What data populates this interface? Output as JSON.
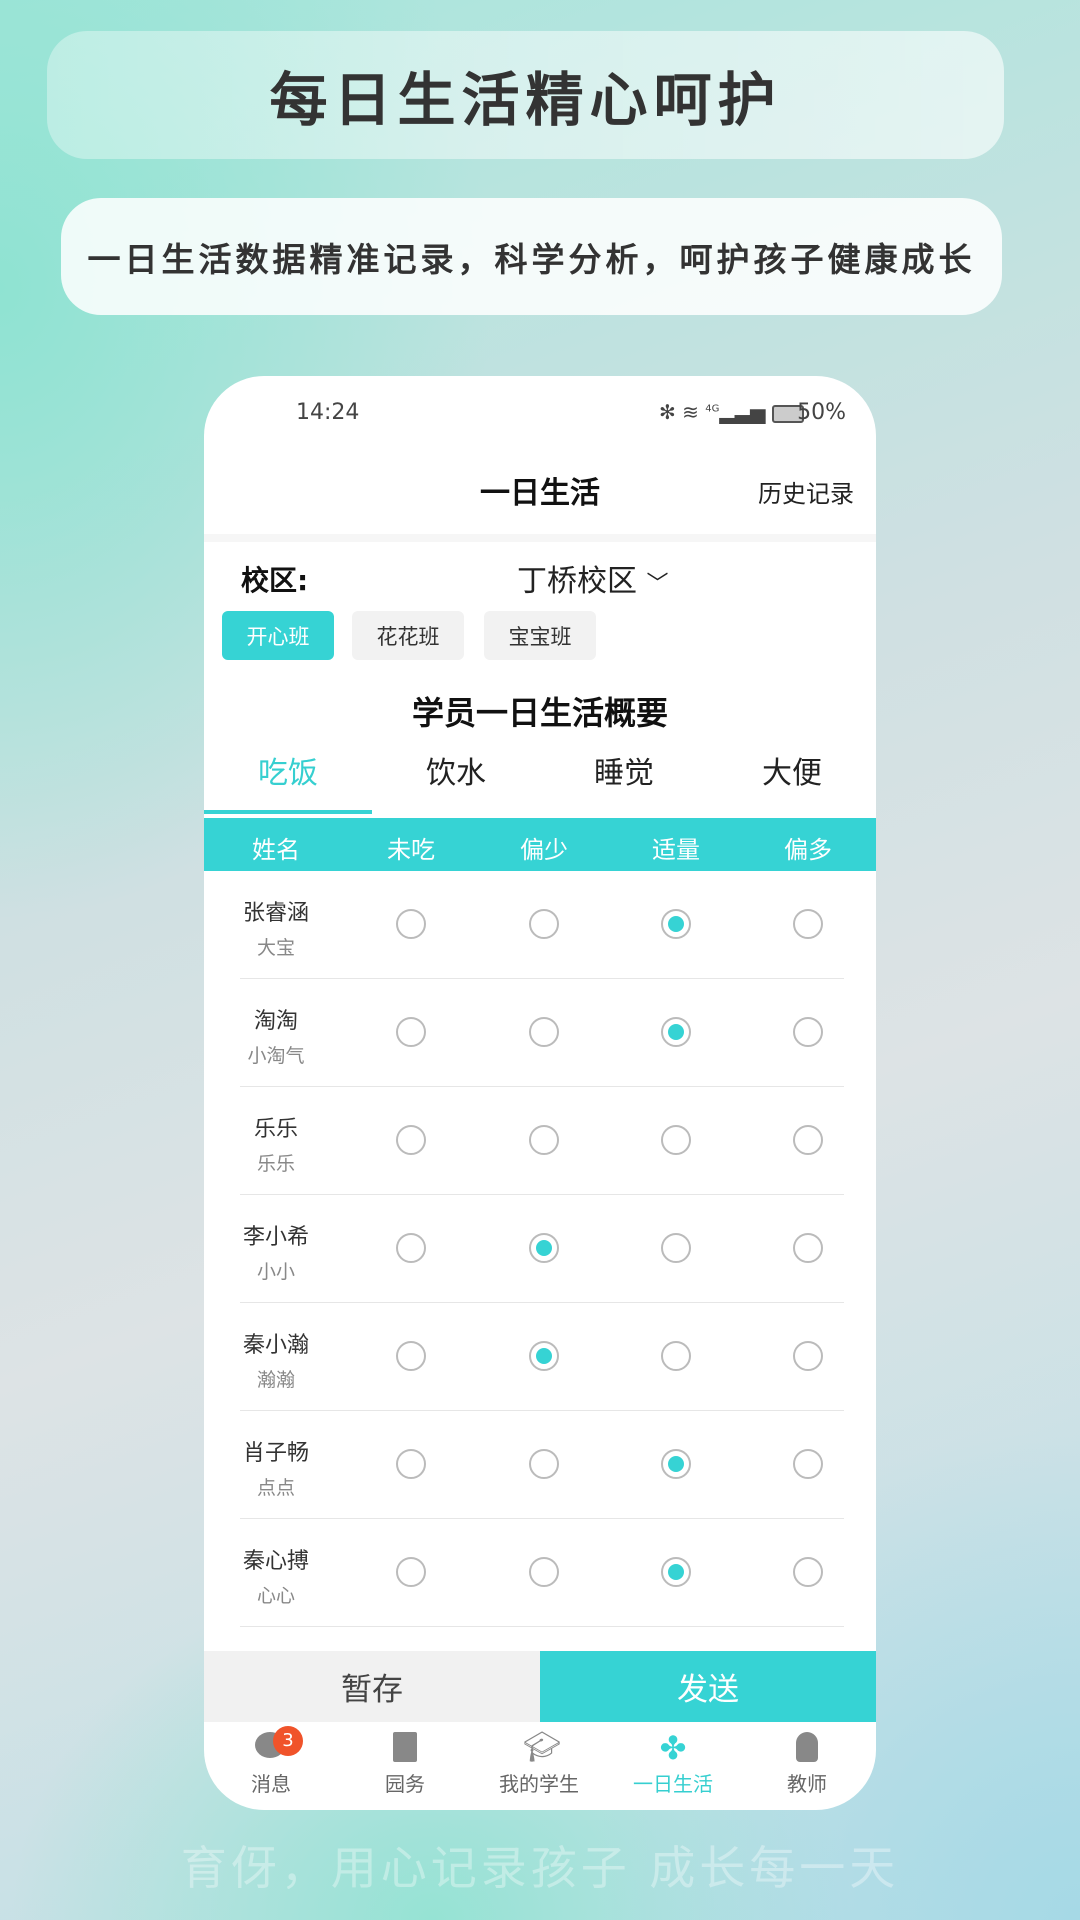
{
  "banner": {
    "title": "每日生活精心呵护",
    "subtitle": "一日生活数据精准记录，科学分析，呵护孩子健康成长"
  },
  "status": {
    "time": "14:24",
    "battery": "50%",
    "network": "4G"
  },
  "header": {
    "title": "一日生活",
    "history": "历史记录"
  },
  "campus": {
    "label": "校区:",
    "value": "丁桥校区"
  },
  "classes": [
    {
      "label": "开心班",
      "active": true
    },
    {
      "label": "花花班",
      "active": false
    },
    {
      "label": "宝宝班",
      "active": false
    }
  ],
  "section_title": "学员一日生活概要",
  "tabs": [
    {
      "label": "吃饭",
      "active": true
    },
    {
      "label": "饮水"
    },
    {
      "label": "睡觉"
    },
    {
      "label": "大便"
    }
  ],
  "columns": [
    "姓名",
    "未吃",
    "偏少",
    "适量",
    "偏多"
  ],
  "students": [
    {
      "name": "张睿涵",
      "nick": "大宝",
      "selected": 2
    },
    {
      "name": "淘淘",
      "nick": "小淘气",
      "selected": 2
    },
    {
      "name": "乐乐",
      "nick": "乐乐",
      "selected": -1
    },
    {
      "name": "李小希",
      "nick": "小小",
      "selected": 1
    },
    {
      "name": "秦小瀚",
      "nick": "瀚瀚",
      "selected": 1
    },
    {
      "name": "肖子畅",
      "nick": "点点",
      "selected": 2
    },
    {
      "name": "秦心搏",
      "nick": "心心",
      "selected": 2
    }
  ],
  "actions": {
    "save": "暂存",
    "send": "发送"
  },
  "nav": [
    {
      "label": "消息",
      "icon": "chat-icon",
      "badge": "3"
    },
    {
      "label": "园务",
      "icon": "building-icon"
    },
    {
      "label": "我的学生",
      "icon": "graduation-cap-icon"
    },
    {
      "label": "一日生活",
      "icon": "clover-icon",
      "active": true
    },
    {
      "label": "教师",
      "icon": "teacher-icon"
    }
  ],
  "footer": "育伢，用心记录孩子 成长每一天",
  "colors": {
    "accent": "#36d3d4",
    "badge": "#f0532a"
  }
}
